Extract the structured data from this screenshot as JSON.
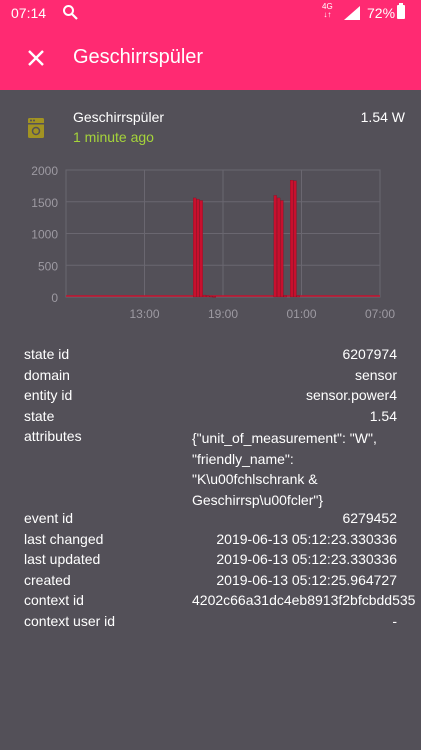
{
  "status_bar": {
    "time": "07:14",
    "network": "4G",
    "battery": "72%"
  },
  "app_bar": {
    "title": "Geschirrspüler"
  },
  "entity": {
    "name": "Geschirrspüler",
    "last_changed": "1 minute ago",
    "value": "1.54 W"
  },
  "chart_data": {
    "type": "bar",
    "x_ticks": [
      "13:00",
      "19:00",
      "01:00",
      "07:00"
    ],
    "y_ticks": [
      "2000",
      "1500",
      "1000",
      "500",
      "0"
    ],
    "ylim": [
      0,
      2000
    ],
    "color": "#c8102e",
    "series": [
      {
        "x": [
          "16:50",
          "17:05",
          "17:20",
          "17:35",
          "17:50",
          "18:05",
          "18:20",
          "23:00",
          "23:15",
          "23:30",
          "23:45",
          "00:15",
          "00:30",
          "00:45"
        ],
        "values": [
          1560,
          1540,
          1520,
          30,
          20,
          15,
          10,
          1600,
          1560,
          1520,
          25,
          1840,
          1830,
          20
        ]
      }
    ]
  },
  "attributes": {
    "state_id": {
      "key": "state id",
      "value": "6207974"
    },
    "domain": {
      "key": "domain",
      "value": "sensor"
    },
    "entity_id": {
      "key": "entity id",
      "value": "sensor.power4"
    },
    "state": {
      "key": "state",
      "value": "1.54"
    },
    "attrs": {
      "key": "attributes",
      "value": "{\"unit_of_measurement\": \"W\", \"friendly_name\": \"K\\u00fchlschrank & Geschirrsp\\u00fcler\"}"
    },
    "event_id": {
      "key": "event id",
      "value": "6279452"
    },
    "last_changed": {
      "key": "last changed",
      "value": "2019-06-13 05:12:23.330336"
    },
    "last_updated": {
      "key": "last updated",
      "value": "2019-06-13 05:12:23.330336"
    },
    "created": {
      "key": "created",
      "value": "2019-06-13 05:12:25.964727"
    },
    "context_id": {
      "key": "context id",
      "value": "4202c66a31dc4eb8913f2bfcbdd535"
    },
    "context_user_id": {
      "key": "context user id",
      "value": "-"
    }
  },
  "colors": {
    "accent": "#ff2a72",
    "background": "#535058",
    "relative_time": "#a5d43a"
  }
}
